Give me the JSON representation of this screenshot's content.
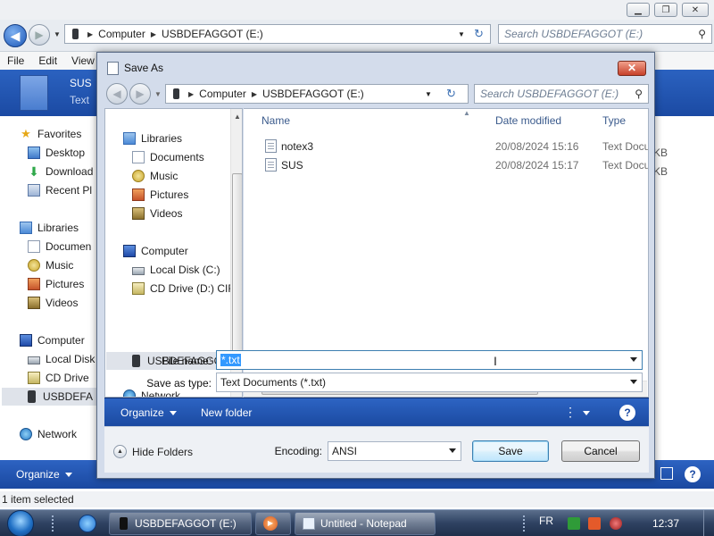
{
  "explorer": {
    "breadcrumb": [
      "Computer",
      "USBDEFAGGOT (E:)"
    ],
    "search_placeholder": "Search USBDEFAGGOT (E:)",
    "menu": [
      "File",
      "Edit",
      "View"
    ],
    "header_title": "SUS",
    "header_subtitle": "Text",
    "nav": {
      "favorites": "Favorites",
      "desktop": "Desktop",
      "downloads": "Download",
      "recent": "Recent Pl",
      "libraries": "Libraries",
      "documents": "Documen",
      "music": "Music",
      "pictures": "Pictures",
      "videos": "Videos",
      "computer": "Computer",
      "local_disk": "Local Disk",
      "cd_drive": "CD Drive",
      "usb": "USBDEFA",
      "network": "Network"
    },
    "sizes": [
      "KB",
      "KB"
    ],
    "organize": "Organize",
    "status": "1 item selected"
  },
  "dialog": {
    "title": "Save As",
    "close": "✕",
    "breadcrumb": [
      "Computer",
      "USBDEFAGGOT (E:)"
    ],
    "search_placeholder": "Search USBDEFAGGOT (E:)",
    "nav": {
      "libraries": "Libraries",
      "documents": "Documents",
      "music": "Music",
      "pictures": "Pictures",
      "videos": "Videos",
      "computer": "Computer",
      "local_disk": "Local Disk (C:)",
      "cd_drive": "CD Drive (D:) CIR",
      "usb": "USBDEFAGGOT (",
      "network": "Network"
    },
    "columns": {
      "name": "Name",
      "date": "Date modified",
      "type": "Type"
    },
    "files": [
      {
        "name": "notex3",
        "date": "20/08/2024 15:16",
        "type": "Text Docu"
      },
      {
        "name": "SUS",
        "date": "20/08/2024 15:17",
        "type": "Text Docu"
      }
    ],
    "file_name_label": "File name:",
    "file_name_value": "*.txt",
    "save_as_type_label": "Save as type:",
    "save_as_type_value": "Text Documents (*.txt)",
    "toolbar": {
      "organize": "Organize",
      "new_folder": "New folder",
      "help": "?"
    },
    "hide_folders": "Hide Folders",
    "encoding_label": "Encoding:",
    "encoding_value": "ANSI",
    "save": "Save",
    "cancel": "Cancel"
  },
  "taskbar": {
    "items": [
      "USBDEFAGGOT (E:)",
      "Untitled - Notepad"
    ],
    "language": "FR",
    "clock": "12:37"
  },
  "colors": {
    "dialog_frame": "#d3dceb",
    "toolbar_blue": "#1b4aa1",
    "selection": "#3399ff",
    "close_red": "#c7412a"
  }
}
